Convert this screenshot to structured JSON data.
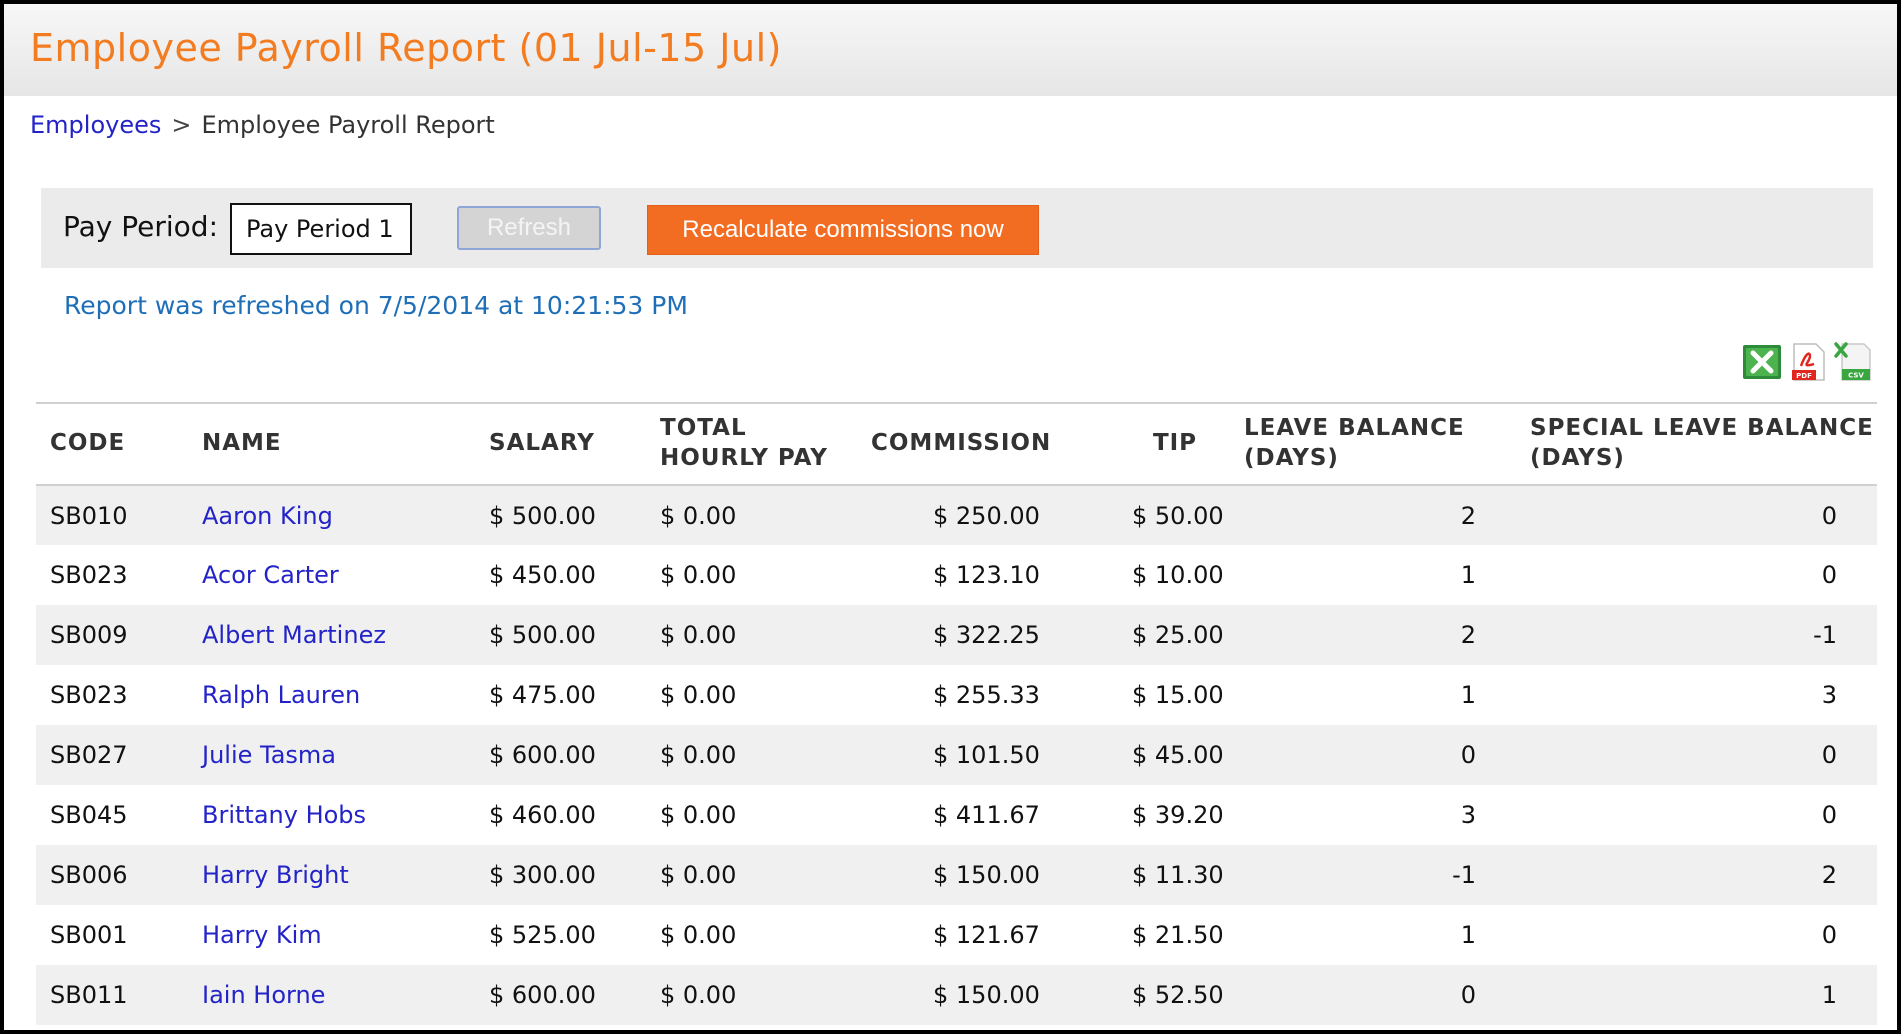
{
  "page": {
    "title": "Employee Payroll Report (01 Jul-15 Jul)"
  },
  "breadcrumb": {
    "parent": "Employees",
    "separator": ">",
    "current": "Employee Payroll Report"
  },
  "filter": {
    "pay_period_label": "Pay Period:",
    "pay_period_value": "Pay Period 1",
    "refresh_label": "Refresh",
    "recalc_label": "Recalculate commissions now"
  },
  "status": {
    "refreshed_text": "Report was refreshed on 7/5/2014 at 10:21:53 PM"
  },
  "export": {
    "icons": [
      "excel-icon",
      "pdf-icon",
      "csv-icon"
    ],
    "pdf_badge": "PDF",
    "csv_badge": "CSV"
  },
  "colors": {
    "title": "#f47c20",
    "accent_button": "#f26d21",
    "link": "#2323c8",
    "status_text": "#1f6fb8"
  },
  "table": {
    "headers": {
      "code": "CODE",
      "name": "NAME",
      "salary": "SALARY",
      "hourly_1": "TOTAL",
      "hourly_2": "HOURLY PAY",
      "commission": "COMMISSION",
      "tip": "TIP",
      "leave_1": "LEAVE BALANCE",
      "leave_2": "(DAYS)",
      "special_1": "SPECIAL LEAVE BALANCE",
      "special_2": "(DAYS)"
    },
    "rows": [
      {
        "code": "SB010",
        "name": "Aaron King",
        "salary": "$ 500.00",
        "hourly": "$ 0.00",
        "commission": "$ 250.00",
        "tip": "$ 50.00",
        "leave": "2",
        "special": "0"
      },
      {
        "code": "SB023",
        "name": "Acor Carter",
        "salary": "$ 450.00",
        "hourly": "$ 0.00",
        "commission": "$ 123.10",
        "tip": "$ 10.00",
        "leave": "1",
        "special": "0"
      },
      {
        "code": "SB009",
        "name": "Albert Martinez",
        "salary": "$ 500.00",
        "hourly": "$ 0.00",
        "commission": "$ 322.25",
        "tip": "$ 25.00",
        "leave": "2",
        "special": "-1"
      },
      {
        "code": "SB023",
        "name": "Ralph Lauren",
        "salary": "$ 475.00",
        "hourly": "$ 0.00",
        "commission": "$ 255.33",
        "tip": "$ 15.00",
        "leave": "1",
        "special": "3"
      },
      {
        "code": "SB027",
        "name": "Julie Tasma",
        "salary": "$ 600.00",
        "hourly": "$ 0.00",
        "commission": "$ 101.50",
        "tip": "$ 45.00",
        "leave": "0",
        "special": "0"
      },
      {
        "code": "SB045",
        "name": "Brittany Hobs",
        "salary": "$ 460.00",
        "hourly": "$ 0.00",
        "commission": "$ 411.67",
        "tip": "$ 39.20",
        "leave": "3",
        "special": "0"
      },
      {
        "code": "SB006",
        "name": "Harry Bright",
        "salary": "$ 300.00",
        "hourly": "$ 0.00",
        "commission": "$ 150.00",
        "tip": "$ 11.30",
        "leave": "-1",
        "special": "2"
      },
      {
        "code": "SB001",
        "name": "Harry Kim",
        "salary": "$ 525.00",
        "hourly": "$ 0.00",
        "commission": "$ 121.67",
        "tip": "$ 21.50",
        "leave": "1",
        "special": "0"
      },
      {
        "code": "SB011",
        "name": "Iain Horne",
        "salary": "$ 600.00",
        "hourly": "$ 0.00",
        "commission": "$ 150.00",
        "tip": "$ 52.50",
        "leave": "0",
        "special": "1"
      }
    ]
  }
}
